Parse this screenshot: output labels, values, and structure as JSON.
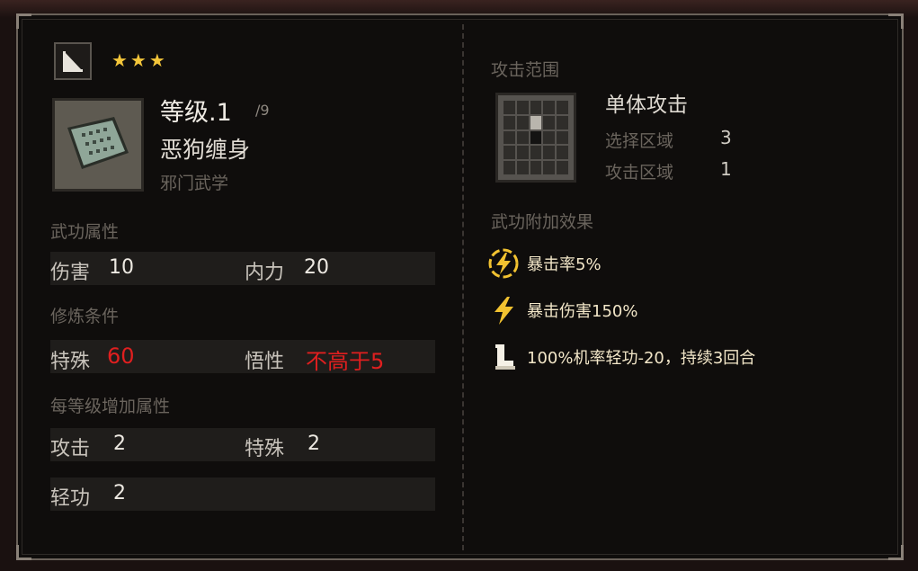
{
  "card": {
    "stars": "★★★",
    "level": "等级.1",
    "level_max": "/9",
    "skill_name": "恶狗缠身",
    "school": "邪门武学"
  },
  "attributes": {
    "title": "武功属性",
    "damage_label": "伤害",
    "damage_value": "10",
    "inner_label": "内力",
    "inner_value": "20"
  },
  "requirements": {
    "title": "修炼条件",
    "special_label": "特殊",
    "special_value": "60",
    "wisdom_label": "悟性",
    "wisdom_value": "不高于5"
  },
  "per_level": {
    "title": "每等级增加属性",
    "attack_label": "攻击",
    "attack_value": "2",
    "special_label": "特殊",
    "special_value": "2",
    "agility_label": "轻功",
    "agility_value": "2"
  },
  "range": {
    "title": "攻击范围",
    "name": "单体攻击",
    "select_label": "选择区域",
    "select_value": "3",
    "attack_label": "攻击区域",
    "attack_value": "1"
  },
  "effects": {
    "title": "武功附加效果",
    "items": [
      {
        "icon": "lightning-circle-icon",
        "text": "暴击率5%"
      },
      {
        "icon": "lightning-icon",
        "text": "暴击伤害150%"
      },
      {
        "icon": "boot-icon",
        "text": "100%机率轻功-20，持续3回合"
      }
    ]
  },
  "colors": {
    "star": "#f3c53a",
    "requirement_red": "#e01f1f",
    "effect_icon": "#f2c230"
  }
}
